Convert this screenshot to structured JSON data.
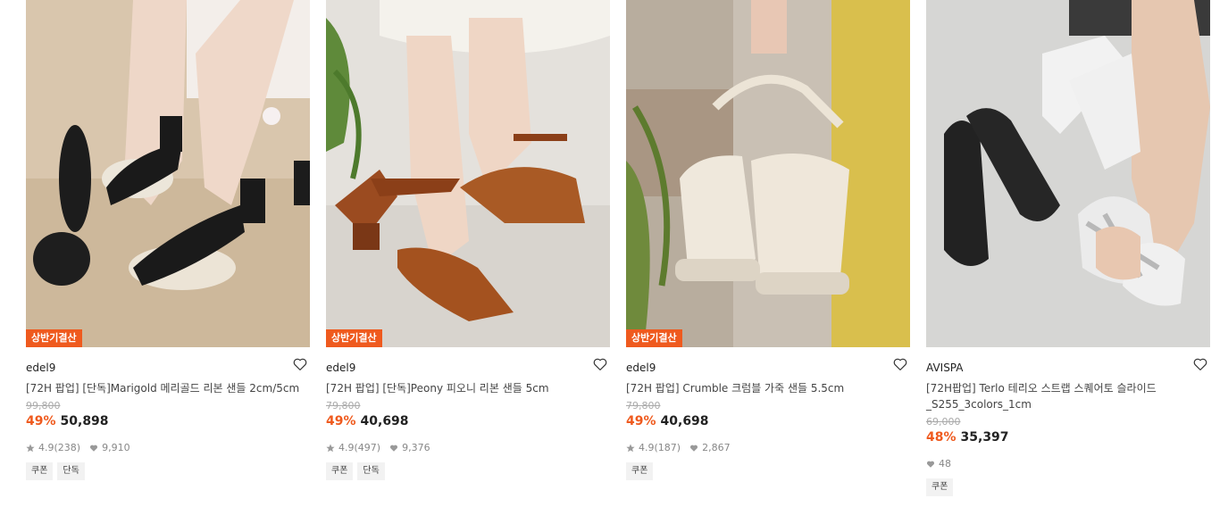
{
  "colors": {
    "accent": "#ef5a1e",
    "badge": "#ef5a1e"
  },
  "products": [
    {
      "badge": "상반기결산",
      "brand": "edel9",
      "title": "[72H 팝업] [단독]Marigold 메리골드 리본 샌들 2cm/5cm",
      "original_price": "99,800",
      "discount": "49%",
      "price": "50,898",
      "rating": "4.9",
      "reviews": "(238)",
      "likes": "9,910",
      "tags": [
        "쿠폰",
        "단독"
      ],
      "image_icon": "product-photo-sandal-black-cream-bow"
    },
    {
      "badge": "상반기결산",
      "brand": "edel9",
      "title": "[72H 팝업] [단독]Peony 피오니 리본 샌들 5cm",
      "original_price": "79,800",
      "discount": "49%",
      "price": "40,698",
      "rating": "4.9",
      "reviews": "(497)",
      "likes": "9,376",
      "tags": [
        "쿠폰",
        "단독"
      ],
      "image_icon": "product-photo-sandal-brown-leather"
    },
    {
      "badge": "상반기결산",
      "brand": "edel9",
      "title": "[72H 팝업] Crumble 크럼블 가죽 샌들 5.5cm",
      "original_price": "79,800",
      "discount": "49%",
      "price": "40,698",
      "rating": "4.9",
      "reviews": "(187)",
      "likes": "2,867",
      "tags": [
        "쿠폰"
      ],
      "image_icon": "product-photo-sandal-ivory-platform"
    },
    {
      "badge": "",
      "brand": "AVISPA",
      "title": "[72H팝업] Terlo 테리오 스트랩 스퀘어토 슬라이드\n_S255_3colors_1cm",
      "original_price": "69,000",
      "discount": "48%",
      "price": "35,397",
      "rating": "",
      "reviews": "",
      "likes": "48",
      "tags": [
        "쿠폰"
      ],
      "image_icon": "product-photo-slide-black-silver-white"
    }
  ]
}
